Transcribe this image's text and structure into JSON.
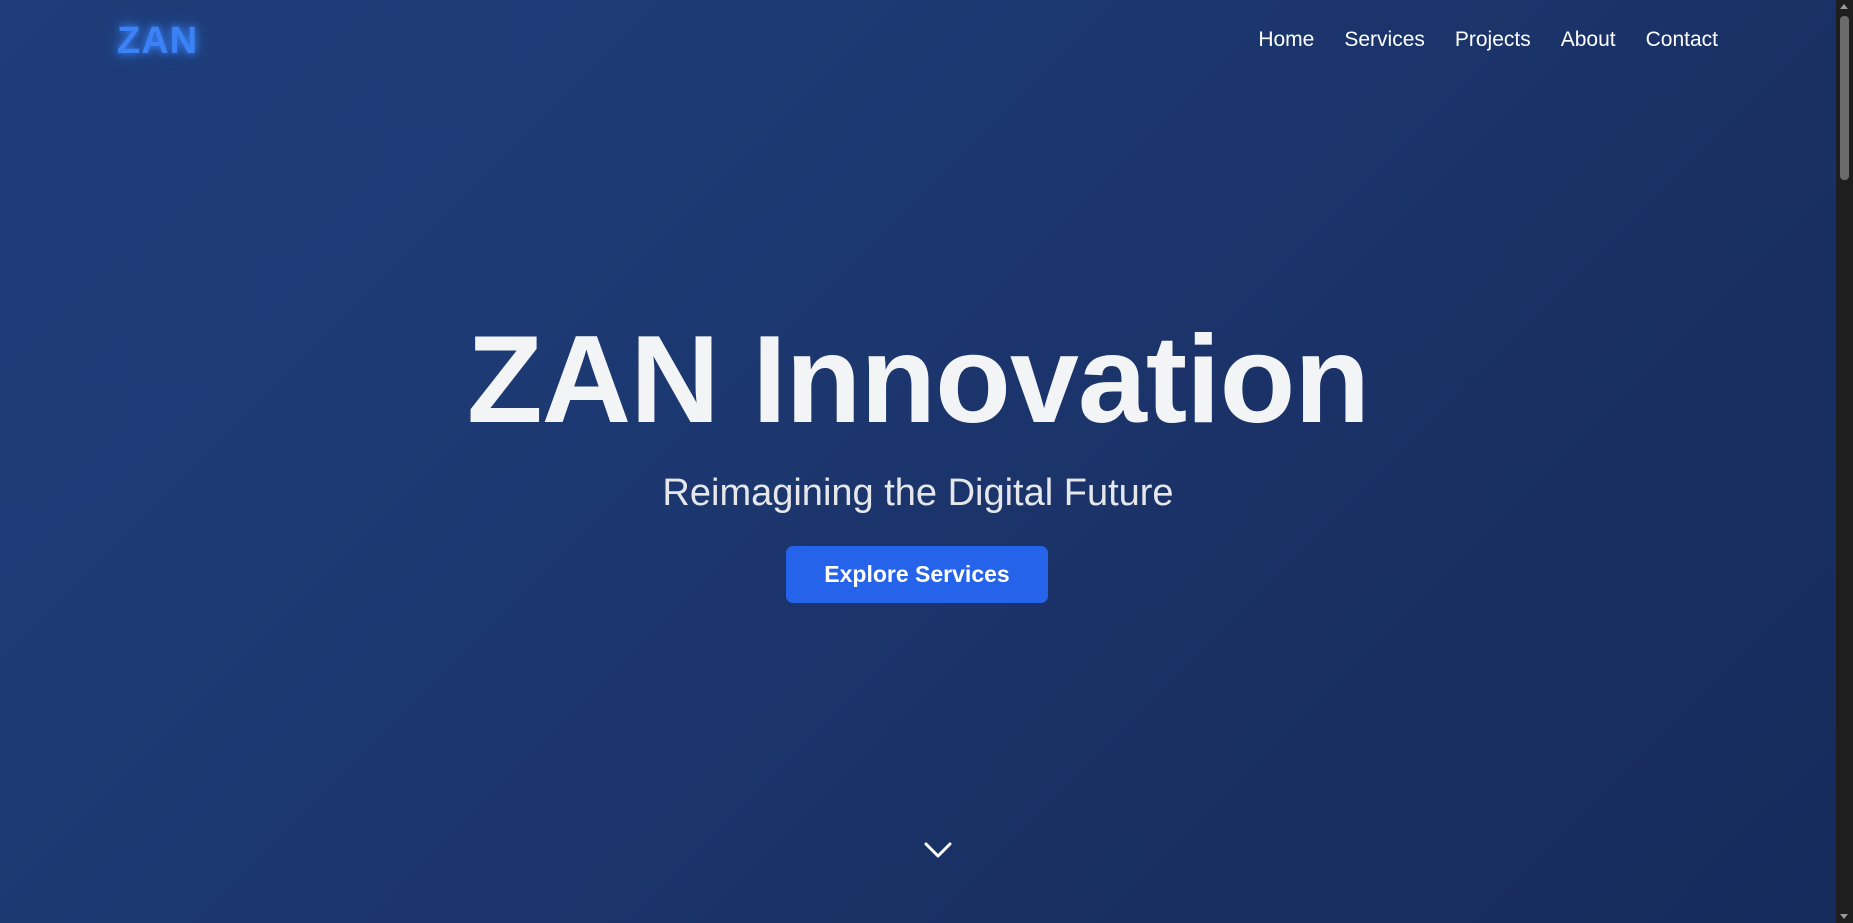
{
  "header": {
    "logo": "ZAN",
    "nav": [
      {
        "label": "Home"
      },
      {
        "label": "Services"
      },
      {
        "label": "Projects"
      },
      {
        "label": "About"
      },
      {
        "label": "Contact"
      }
    ]
  },
  "hero": {
    "title": "ZAN Innovation",
    "subtitle": "Reimagining the Digital Future",
    "cta_label": "Explore Services",
    "scroll_icon": "chevron-down-icon"
  },
  "colors": {
    "accent": "#3b82f6",
    "button": "#2563eb",
    "background_start": "#1e3d79",
    "background_end": "#172a5c"
  }
}
